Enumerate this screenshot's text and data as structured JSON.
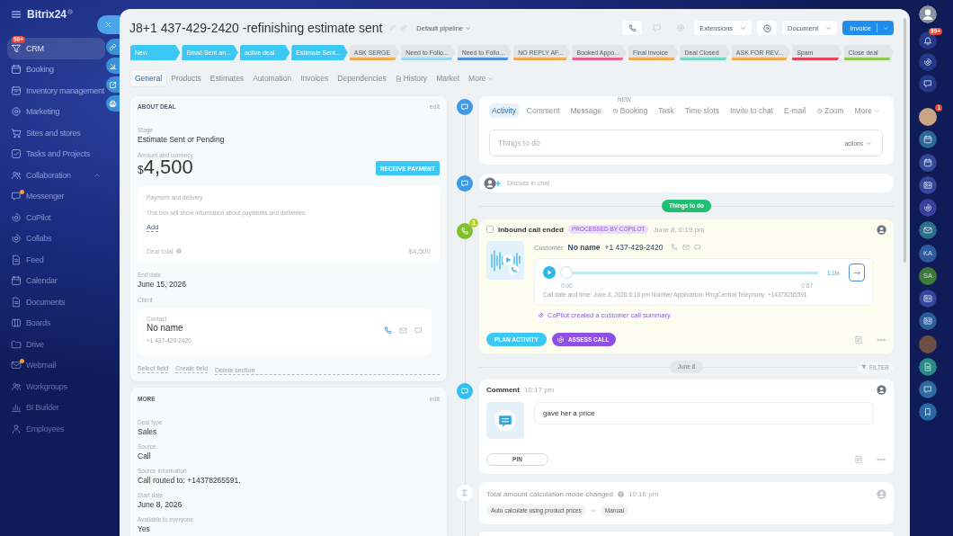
{
  "nav": {
    "logo": "Bitrix24",
    "items": [
      {
        "label": "CRM",
        "kind": "item",
        "selected": true,
        "unread": false,
        "badge": "99+"
      },
      {
        "label": "Booking",
        "kind": "item",
        "selected": false,
        "unread": false
      },
      {
        "label": "Inventory management",
        "kind": "item",
        "selected": false,
        "unread": false
      },
      {
        "label": "Marketing",
        "kind": "item",
        "selected": false,
        "unread": false
      },
      {
        "label": "Sites and stores",
        "kind": "item",
        "selected": false,
        "unread": false
      },
      {
        "label": "Tasks and Projects",
        "kind": "item",
        "selected": false,
        "unread": false
      },
      {
        "label": "Collaboration",
        "kind": "group",
        "selected": false,
        "unread": false
      },
      {
        "label": "Messenger",
        "kind": "item",
        "selected": false,
        "unread": true
      },
      {
        "label": "CoPilot",
        "kind": "item",
        "selected": false,
        "unread": false
      },
      {
        "label": "Collabs",
        "kind": "item",
        "selected": false,
        "unread": false
      },
      {
        "label": "Feed",
        "kind": "item",
        "selected": false,
        "unread": false
      },
      {
        "label": "Calendar",
        "kind": "item",
        "selected": false,
        "unread": false
      },
      {
        "label": "Documents",
        "kind": "item",
        "selected": false,
        "unread": false
      },
      {
        "label": "Boards",
        "kind": "item",
        "selected": false,
        "unread": false
      },
      {
        "label": "Drive",
        "kind": "item",
        "selected": false,
        "unread": false
      },
      {
        "label": "Webmail",
        "kind": "item",
        "selected": false,
        "unread": true
      },
      {
        "label": "Workgroups",
        "kind": "item",
        "selected": false,
        "unread": false
      },
      {
        "label": "BI Builder",
        "kind": "item",
        "selected": false,
        "unread": false
      },
      {
        "label": "Employees",
        "kind": "item",
        "selected": false,
        "unread": false
      }
    ]
  },
  "header": {
    "title": "J8+1 437-429-2420 -refinishing estimate sent",
    "pipeline": "Default pipeline",
    "extensions": "Extensions",
    "document": "Document",
    "invoice": "Invoice"
  },
  "stages": [
    {
      "label": "New",
      "color": "#3bc8f5",
      "reached": true
    },
    {
      "label": "Email Sent an...",
      "color": "#3bc8f5",
      "reached": true
    },
    {
      "label": "active deal",
      "color": "#3bc8f5",
      "reached": true
    },
    {
      "label": "Estimate Sent...",
      "color": "#3bc8f5",
      "reached": true
    },
    {
      "label": "ASK SERGE",
      "color": "#f2a94c",
      "reached": false
    },
    {
      "label": "Need to Follo...",
      "color": "#9dd5f3",
      "reached": false
    },
    {
      "label": "Need to Follo...",
      "color": "#4d8fe6",
      "reached": false
    },
    {
      "label": "NO REPLY AF...",
      "color": "#f2a94c",
      "reached": false
    },
    {
      "label": "Booked Appo...",
      "color": "#e8608f",
      "reached": false
    },
    {
      "label": "Final invoice",
      "color": "#f2a94c",
      "reached": false
    },
    {
      "label": "Deal Closed",
      "color": "#72d8c4",
      "reached": false
    },
    {
      "label": "ASK FOR REV...",
      "color": "#f2a94c",
      "reached": false
    },
    {
      "label": "Spam",
      "color": "#e2445a",
      "reached": false
    },
    {
      "label": "Close deal",
      "color": "#8fc94f",
      "reached": false
    }
  ],
  "tabs": [
    {
      "label": "General",
      "kind": "plain",
      "selected": true
    },
    {
      "label": "Products",
      "kind": "plain",
      "selected": false
    },
    {
      "label": "Estimates",
      "kind": "plain",
      "selected": false
    },
    {
      "label": "Automation",
      "kind": "plain",
      "selected": false
    },
    {
      "label": "Invoices",
      "kind": "plain",
      "selected": false
    },
    {
      "label": "Dependencies",
      "kind": "plain",
      "selected": false
    },
    {
      "label": "History",
      "kind": "icon",
      "selected": false
    },
    {
      "label": "Market",
      "kind": "plain",
      "selected": false
    },
    {
      "label": "More",
      "kind": "menu",
      "selected": false
    }
  ],
  "about_deal": {
    "title": "ABOUT DEAL",
    "edit": "edit",
    "stage_label": "Stage",
    "stage": "Estimate Sent or Pending",
    "amount_label": "Amount and currency",
    "currency": "$",
    "amount": "4,500",
    "receive_payment": "RECEIVE PAYMENT",
    "payment": {
      "title": "Payment and delivery",
      "text": "This box will show information about payments and deliveries.",
      "add": "Add",
      "total_label": "Deal total",
      "total": "$4,500"
    },
    "end_date_label": "End date",
    "end_date": "June 15, 2026",
    "client_label": "Client",
    "contact": {
      "label": "Contact",
      "name": "No name",
      "phone": "+1 437-429-2420"
    },
    "links": [
      "Select field",
      "Create field"
    ],
    "delete": "Delete section"
  },
  "more_section": {
    "title": "MORE",
    "edit": "edit",
    "fields": [
      {
        "label": "Deal type",
        "value": "Sales"
      },
      {
        "label": "Source",
        "value": "Call"
      },
      {
        "label": "Source information",
        "value": "Call routed to: +14378265591."
      },
      {
        "label": "Start date",
        "value": "June 8, 2026"
      },
      {
        "label": "Available to everyone",
        "value": "Yes"
      }
    ]
  },
  "activity_editor": {
    "tabs": [
      {
        "label": "Activity",
        "kind": "plain",
        "selected": true
      },
      {
        "label": "Comment",
        "kind": "plain",
        "selected": false
      },
      {
        "label": "Message",
        "kind": "plain",
        "selected": false
      },
      {
        "label": "Booking",
        "kind": "icon",
        "selected": false,
        "badge": "NEW"
      },
      {
        "label": "Task",
        "kind": "plain",
        "selected": false
      },
      {
        "label": "Time slots",
        "kind": "plain",
        "selected": false
      },
      {
        "label": "Invite to chat",
        "kind": "plain",
        "selected": false
      },
      {
        "label": "E-mail",
        "kind": "plain",
        "selected": false
      },
      {
        "label": "Zoom",
        "kind": "icon",
        "selected": false
      },
      {
        "label": "More",
        "kind": "menu",
        "selected": false
      }
    ],
    "placeholder": "Things to do",
    "actions": "actions"
  },
  "discuss": "Discuss in chat",
  "timeline": {
    "group_label": "Things to do",
    "call": {
      "count": "1",
      "checked": false,
      "title": "Inbound call ended",
      "tag": "PROCESSED BY COPILOT",
      "time": "June 8, 6:19 pm",
      "customer_label": "Customer",
      "customer_name": "No name",
      "customer_phone": "+1 437-429-2420",
      "player": {
        "level": 0,
        "start": "0:00",
        "end": "0:57",
        "speed": "1.0x"
      },
      "details": "Call date and time: June 8, 2026 6:18 pm Number Application: RingCentral Telephony: +14378265591",
      "summary": "CoPilot created a customer call summary",
      "buttons": [
        {
          "label": "PLAN ACTIVITY",
          "kind": "primary"
        },
        {
          "label": "ASSESS CALL",
          "kind": "copilot"
        }
      ]
    },
    "date_label": "June 8",
    "filter": "FILTER",
    "comment": {
      "title": "Comment",
      "time": "10:17 pm",
      "text": "gave her a price",
      "pin": "PIN"
    },
    "change": {
      "title": "Total amount calculation mode changed",
      "time": "10:16 pm",
      "from": "Auto calculate using product prices",
      "to": "Manual"
    }
  },
  "right_rail": [
    {
      "kind": "avatar",
      "color": "#8a94a3"
    },
    {
      "kind": "icon",
      "color": "#24398a",
      "badge": "99+"
    },
    {
      "kind": "icon",
      "color": "#24398a"
    },
    {
      "kind": "icon",
      "color": "#24398a"
    },
    {
      "kind": "photo",
      "color": "#c9a584",
      "badge": "1"
    },
    {
      "kind": "icon",
      "color": "#2d6a93"
    },
    {
      "kind": "icon",
      "color": "#34479a"
    },
    {
      "kind": "icon",
      "color": "#34479a"
    },
    {
      "kind": "icon",
      "color": "#3a3f9c"
    },
    {
      "kind": "icon",
      "color": "#2d6f86"
    },
    {
      "kind": "initials",
      "text": "KA",
      "color": "#2f5b9c"
    },
    {
      "kind": "initials",
      "text": "SA",
      "color": "#3d7a37"
    },
    {
      "kind": "icon",
      "color": "#34479a"
    },
    {
      "kind": "icon",
      "color": "#2f5f9a"
    },
    {
      "kind": "photo",
      "color": "#6e4f46"
    },
    {
      "kind": "icon",
      "color": "#2c8a85"
    },
    {
      "kind": "icon",
      "color": "#2e6aa0"
    },
    {
      "kind": "icon",
      "color": "#2a68a3"
    }
  ]
}
